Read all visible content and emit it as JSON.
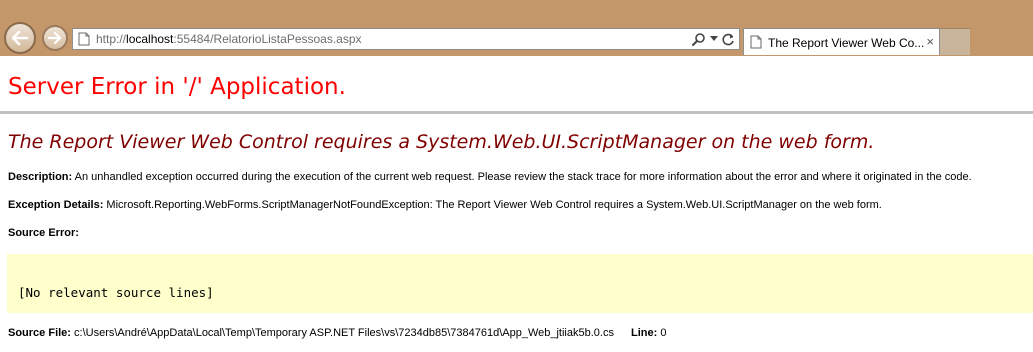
{
  "browser": {
    "url_prefix": "http://",
    "url_host": "localhost",
    "url_rest": ":55484/RelatorioListaPessoas.aspx",
    "tab_title": "The Report Viewer Web Co...",
    "tab_close": "×"
  },
  "page": {
    "heading": "Server Error in '/' Application.",
    "error_message": "The Report Viewer Web Control requires a System.Web.UI.ScriptManager on the web form.",
    "description_label": "Description:",
    "description_text": "An unhandled exception occurred during the execution of the current web request. Please review the stack trace for more information about the error and where it originated in the code.",
    "exception_label": "Exception Details:",
    "exception_text": "Microsoft.Reporting.WebForms.ScriptManagerNotFoundException: The Report Viewer Web Control requires a System.Web.UI.ScriptManager on the web form.",
    "source_error_label": "Source Error:",
    "source_error_text": "[No relevant source lines]",
    "source_file_label": "Source File:",
    "source_file_text": "c:\\Users\\André\\AppData\\Local\\Temp\\Temporary ASP.NET Files\\vs\\7234db85\\7384761d\\App_Web_jtiiak5b.0.cs",
    "line_label": "Line:",
    "line_value": "0"
  },
  "colors": {
    "chrome": "#c4976a",
    "heading": "#ff0000",
    "error_message": "#800000",
    "source_box": "#ffffcc"
  },
  "icons": {
    "back": "back-arrow-icon",
    "forward": "forward-arrow-icon",
    "page": "page-icon",
    "search": "search-icon",
    "dropdown": "dropdown-arrow-icon",
    "refresh": "refresh-icon",
    "close": "close-icon"
  }
}
